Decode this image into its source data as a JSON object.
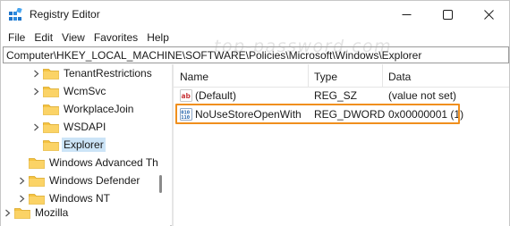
{
  "window": {
    "title": "Registry Editor",
    "watermark": "top-password.com",
    "controls": {
      "minimize_icon": "minimize-icon",
      "maximize_icon": "maximize-icon",
      "close_icon": "close-icon"
    }
  },
  "menu": {
    "items": [
      "File",
      "Edit",
      "View",
      "Favorites",
      "Help"
    ]
  },
  "address": {
    "path": "Computer\\HKEY_LOCAL_MACHINE\\SOFTWARE\\Policies\\Microsoft\\Windows\\Explorer"
  },
  "tree": {
    "items": [
      {
        "label": "TenantRestrictions",
        "expandable": true,
        "selected": false
      },
      {
        "label": "WcmSvc",
        "expandable": true,
        "selected": false
      },
      {
        "label": "WorkplaceJoin",
        "expandable": false,
        "selected": false
      },
      {
        "label": "WSDAPI",
        "expandable": true,
        "selected": false
      },
      {
        "label": "Explorer",
        "expandable": false,
        "selected": true
      },
      {
        "label": "Windows Advanced Th",
        "expandable": false,
        "selected": false
      },
      {
        "label": "Windows Defender",
        "expandable": true,
        "selected": false
      },
      {
        "label": "Windows NT",
        "expandable": true,
        "selected": false
      },
      {
        "label": "Mozilla",
        "expandable": true,
        "selected": false
      }
    ]
  },
  "list": {
    "columns": [
      "Name",
      "Type",
      "Data"
    ],
    "rows": [
      {
        "name": "(Default)",
        "type": "REG_SZ",
        "data": "(value not set)",
        "icon": "string-value-icon"
      },
      {
        "name": "NoUseStoreOpenWith",
        "type": "REG_DWORD",
        "data": "0x00000001 (1)",
        "icon": "dword-value-icon",
        "highlighted": true
      }
    ]
  },
  "colors": {
    "selection": "#cce4f7",
    "highlight_border": "#f08f1d",
    "folder": "#f5c342",
    "string_icon_red": "#c8383b",
    "dword_icon_blue": "#1f5fa8"
  }
}
